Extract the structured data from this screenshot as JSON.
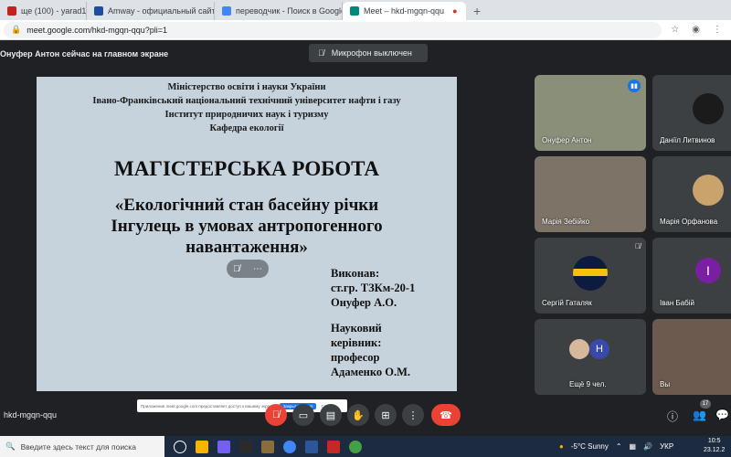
{
  "tabs": [
    {
      "label": "ще (100) - yarad1964@gm",
      "icon_color": "#c5221f",
      "active": false
    },
    {
      "label": "Amway - официальный сайт и и",
      "icon_color": "#1a4fa0",
      "active": false
    },
    {
      "label": "переводчик - Поиск в Google",
      "icon_color": "#4285f4",
      "active": false
    },
    {
      "label": "Meet – hkd-mgqn-qqu",
      "icon_color": "#00897b",
      "active": true
    }
  ],
  "address": {
    "url": "meet.google.com/hkd-mgqn-qqu?pli=1"
  },
  "meeting": {
    "presenter_text": "Онуфер Антон сейчас на главном экране",
    "mic_status": "Микрофон выключен",
    "code": "hkd-mgqn-qqu",
    "participants_count": "17"
  },
  "slide": {
    "lines": [
      "Міністерство освіти і науки України",
      "Івано-Франківський національний технічний університет нафти і газу",
      "Інститут природничих наук і туризму",
      "Кафедра екології"
    ],
    "title": "МАГІСТЕРСЬКА РОБОТА",
    "topic": [
      "«Екологічний стан басейну річки",
      "Інгулець в умовах антропогенного",
      "навантаження»"
    ],
    "author_lines": [
      "Виконав:",
      "ст.гр. ТЗКм-20-1",
      "Онуфер А.О."
    ],
    "advisor_lines": [
      "Науковий",
      "керівник:",
      "професор",
      "Адаменко О.М."
    ]
  },
  "notification": {
    "text": "Приложение meet.google.com предоставляет доступ к вашему экрану.",
    "stop": "Закрыть доступ",
    "hide": "Скрыть"
  },
  "participants": [
    {
      "name": "Онуфер Антон",
      "bg": "#8a8f7a"
    },
    {
      "name": "Даніїл Литвинов",
      "bg": "#3c4043"
    },
    {
      "name": "Марія Зебійко",
      "bg": "#7d7366"
    },
    {
      "name": "Марія Орфанова",
      "bg": "#3c4043"
    },
    {
      "name": "Сергій Гаталяк",
      "bg": "#3c4043"
    },
    {
      "name": "Іван Бабій",
      "bg": "#3c4043",
      "initial": "І",
      "avatar_color": "#7b1fa2"
    },
    {
      "name": "Ещё 9 чел.",
      "bg": "#3c4043",
      "initial": "H",
      "avatar_color": "#3949ab"
    },
    {
      "name": "Вы",
      "bg": "#6b5a4d"
    }
  ],
  "taskbar": {
    "search_placeholder": "Введите здесь текст для поиска",
    "weather": "-5°C  Sunny",
    "lang": "УКР",
    "time": "10:5",
    "date": "23.12.2"
  }
}
